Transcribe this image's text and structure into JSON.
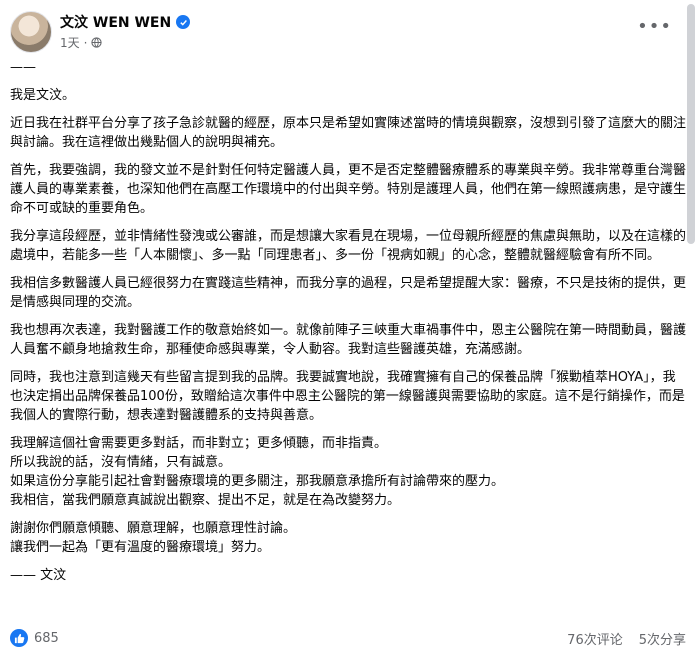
{
  "post": {
    "author": "文汶 WEN WEN",
    "time": "1天",
    "body": [
      "——",
      "我是文汶。",
      "近日我在社群平台分享了孩子急診就醫的經歷，原本只是希望如實陳述當時的情境與觀察，沒想到引發了這麼大的關注與討論。我在這裡做出幾點個人的說明與補充。",
      "首先，我要強調，我的發文並不是針對任何特定醫護人員，更不是否定整體醫療體系的專業與辛勞。我非常尊重台灣醫護人員的專業素養，也深知他們在高壓工作環境中的付出與辛勞。特別是護理人員，他們在第一線照護病患，是守護生命不可或缺的重要角色。",
      "我分享這段經歷，並非情緒性發洩或公審誰，而是想讓大家看見在現場，一位母親所經歷的焦慮與無助，以及在這樣的處境中，若能多一些「人本關懷」、多一點「同理患者」、多一份「視病如親」的心念，整體就醫經驗會有所不同。",
      "我相信多數醫護人員已經很努力在實踐這些精神，而我分享的過程，只是希望提醒大家：醫療，不只是技術的提供，更是情感與同理的交流。",
      "我也想再次表達，我對醫護工作的敬意始終如一。就像前陣子三峽重大車禍事件中，恩主公醫院在第一時間動員，醫護人員奮不顧身地搶救生命，那種使命感與專業，令人動容。我對這些醫護英雄，充滿感謝。",
      "同時，我也注意到這幾天有些留言提到我的品牌。我要誠實地說，我確實擁有自己的保養品牌「猴勦植萃HOYA」，我也決定捐出品牌保養品100份，致贈給這次事件中恩主公醫院的第一線醫護與需要協助的家庭。這不是行銷操作，而是我個人的實際行動，想表達對醫護體系的支持與善意。",
      "我理解這個社會需要更多對話，而非對立；更多傾聽，而非指責。\n所以我說的話，沒有情緒，只有誠意。\n如果這份分享能引起社會對醫療環境的更多關注，那我願意承擔所有討論帶來的壓力。\n我相信，當我們願意真誠說出觀察、提出不足，就是在為改變努力。",
      "謝謝你們願意傾聽、願意理解，也願意理性討論。\n讓我們一起為「更有溫度的醫療環境」努力。",
      "—— 文汶"
    ]
  },
  "footer": {
    "reactions": "685",
    "comments": "76次评论",
    "shares": "5次分享"
  },
  "colors": {
    "accent": "#1877f2",
    "secondary_text": "#65676b"
  }
}
